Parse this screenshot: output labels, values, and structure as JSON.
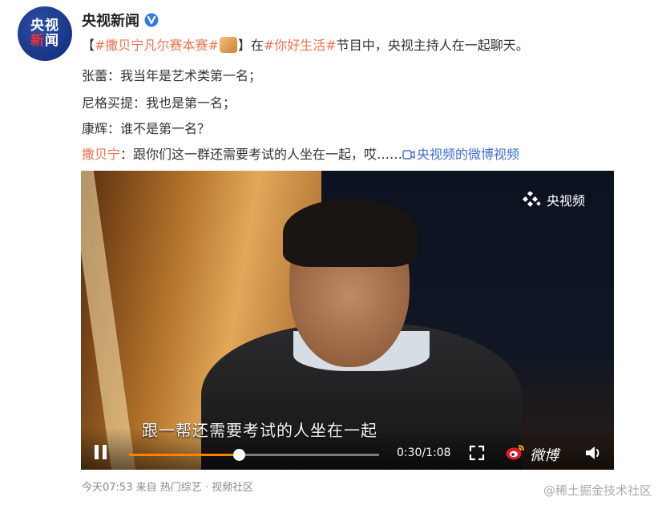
{
  "author": {
    "name": "央视新闻",
    "avatar_line1": "央视",
    "avatar_line2_red": "新",
    "avatar_line2": "闻"
  },
  "post": {
    "line1": {
      "bracket_open": "【",
      "tag1": "#撒贝宁",
      "tag1_rest": "凡尔赛本赛#",
      "bracket_close": "】",
      "text_a": "在",
      "tag2": "#你好生活#",
      "text_b": "节目中，央视主持人在一起聊天。"
    },
    "line2": {
      "speaker": "张蕾：",
      "text": "我当年是艺术类第一名；"
    },
    "line3": {
      "speaker": "尼格买提：",
      "text": "我也是第一名；"
    },
    "line4": {
      "speaker": "康辉：",
      "text": "谁不是第一名？"
    },
    "line5": {
      "speaker": "撒贝宁",
      "text": "：跟你们这一群还需要考试的人坐在一起，哎……",
      "link": "央视频的微博视频"
    }
  },
  "video": {
    "logo_text": "央视频",
    "subtitle": "跟一帮还需要考试的人坐在一起",
    "current_time": "0:30",
    "duration": "1:08",
    "time_display": "0:30/1:08",
    "progress": 0.44,
    "brand": "微博"
  },
  "footer": {
    "time": "今天07:53",
    "source_prefix": "来自",
    "source": "热门综艺 · 视频社区"
  },
  "watermark": "@稀土掘金技术社区",
  "colors": {
    "accent": "#eb7350",
    "link": "#3f6fd1",
    "progress": "#ff8200",
    "avatar_blue": "#1b3a8f"
  }
}
